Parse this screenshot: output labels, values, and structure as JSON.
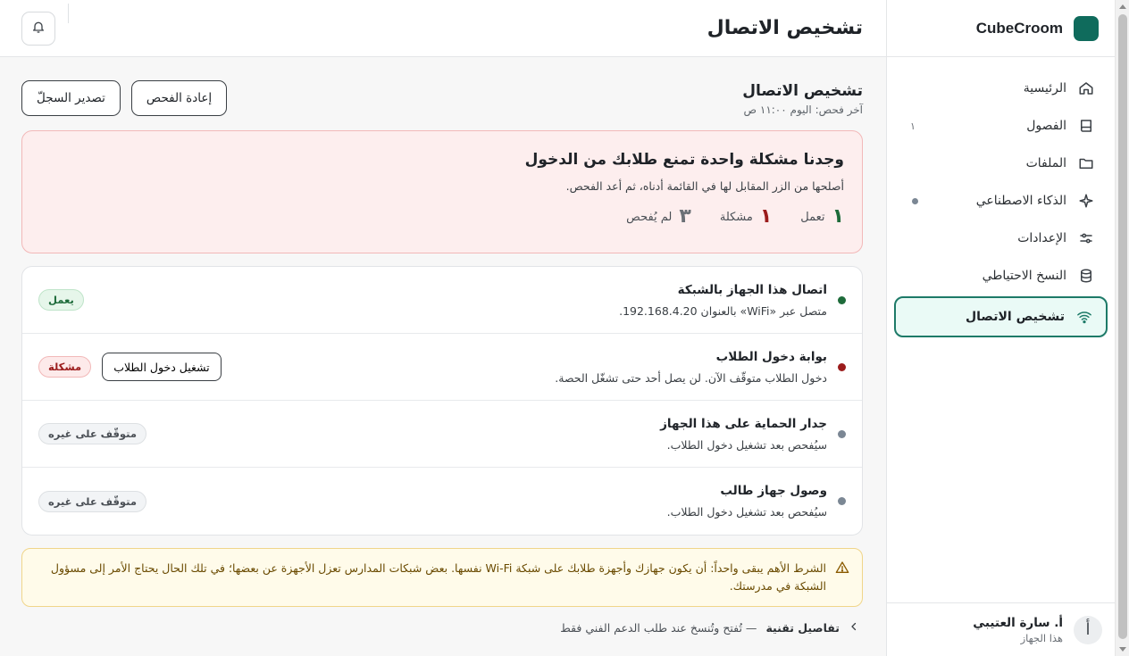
{
  "brand": {
    "name": "CubeCroom",
    "color": "#0f6b5c"
  },
  "sidebar": {
    "items": [
      {
        "label": "الرئيسية",
        "icon": "home-icon"
      },
      {
        "label": "الفصول",
        "icon": "book-icon",
        "count": "١"
      },
      {
        "label": "الملفات",
        "icon": "folder-icon"
      },
      {
        "label": "الذكاء الاصطناعي",
        "icon": "sparkle-icon"
      },
      {
        "label": "الإعدادات",
        "icon": "sliders-icon"
      },
      {
        "label": "النسخ الاحتياطي",
        "icon": "database-icon"
      },
      {
        "label": "تشخيص الاتصال",
        "icon": "wifi-icon",
        "active": true
      }
    ]
  },
  "user": {
    "name": "أ. سارة العتيبي",
    "sub": "هذا الجهاز",
    "avatar_letter": "أ"
  },
  "header": {
    "title": "تشخيص الاتصال"
  },
  "section": {
    "title": "تشخيص الاتصال",
    "last_check": "آخر فحص: اليوم ١١:٠٠ ص",
    "rescan_label": "إعادة الفحص",
    "export_label": "تصدير السجلّ"
  },
  "alert": {
    "title": "وجدنا مشكلة واحدة تمنع طلابك من الدخول",
    "desc": "أصلحها من الزر المقابل لها في القائمة أدناه، ثم أعد الفحص.",
    "stats": [
      {
        "num": "١",
        "label": "تعمل"
      },
      {
        "num": "١",
        "label": "مشكلة"
      },
      {
        "num": "٣",
        "label": "لم يُفحص"
      }
    ]
  },
  "checks": [
    {
      "title": "اتصال هذا الجهاز بالشبكة",
      "desc": "متصل عبر «WiFi» بالعنوان 192.168.4.20.",
      "status": "يعمل"
    },
    {
      "title": "بوابة دخول الطلاب",
      "desc": "دخول الطلاب متوقّف الآن. لن يصل أحد حتى تشغّل الحصة.",
      "status": "مشكلة",
      "action": "تشغيل دخول الطلاب"
    },
    {
      "title": "جدار الحماية على هذا الجهاز",
      "desc": "سيُفحص بعد تشغيل دخول الطلاب.",
      "status": "متوقّف على غيره"
    },
    {
      "title": "وصول جهاز طالب",
      "desc": "سيُفحص بعد تشغيل دخول الطلاب.",
      "status": "متوقّف على غيره"
    }
  ],
  "note": {
    "text": "الشرط الأهم يبقى واحداً: أن يكون جهازك وأجهزة طلابك على شبكة Wi-Fi نفسها. بعض شبكات المدارس تعزل الأجهزة عن بعضها؛ في تلك الحال يحتاج الأمر إلى مسؤول الشبكة في مدرستك."
  },
  "tech": {
    "title": "تفاصيل تقنية",
    "sub": "— تُفتح وتُنسخ عند طلب الدعم الفني فقط"
  },
  "colors": {
    "ok": "#1e6b3a",
    "bad": "#9b1c1c",
    "neutral": "#7b8794",
    "accent": "#1d7a68"
  }
}
